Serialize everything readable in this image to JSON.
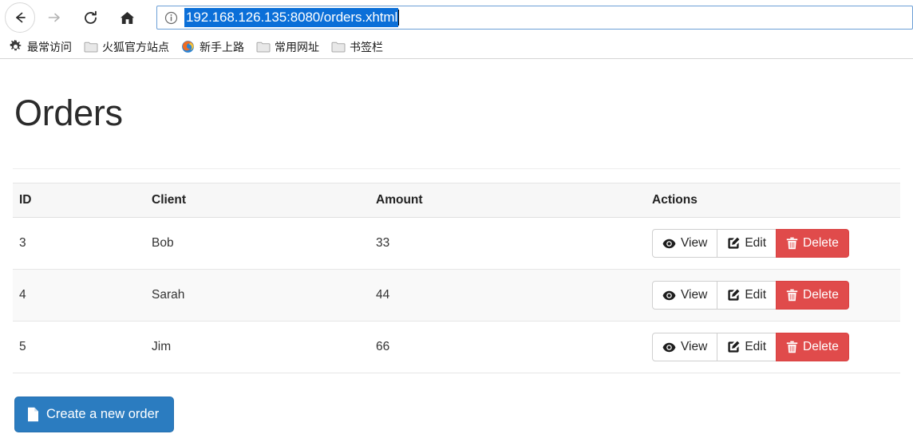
{
  "browser": {
    "nav": {
      "back_label": "Back",
      "forward_label": "Forward",
      "reload_label": "Reload",
      "home_label": "Home"
    },
    "url_bar": {
      "value": "192.168.126.135:8080/orders.xhtml",
      "identity_icon": "info-circle-icon",
      "selected": true,
      "selection_color": "#0b6fd8"
    },
    "bookmarks": [
      {
        "label": "最常访问",
        "icon": "gear-icon"
      },
      {
        "label": "火狐官方站点",
        "icon": "folder-icon"
      },
      {
        "label": "新手上路",
        "icon": "firefox-logo-icon"
      },
      {
        "label": "常用网址",
        "icon": "folder-icon"
      },
      {
        "label": "书签栏",
        "icon": "folder-icon"
      }
    ]
  },
  "page": {
    "title": "Orders",
    "table": {
      "columns": [
        "ID",
        "Client",
        "Amount",
        "Actions"
      ],
      "rows": [
        {
          "id": "3",
          "client": "Bob",
          "amount": "33"
        },
        {
          "id": "4",
          "client": "Sarah",
          "amount": "44"
        },
        {
          "id": "5",
          "client": "Jim",
          "amount": "66"
        }
      ],
      "actions": {
        "view_label": "View",
        "edit_label": "Edit",
        "delete_label": "Delete",
        "view_icon": "eye-icon",
        "edit_icon": "pen-to-square-icon",
        "delete_icon": "trash-icon",
        "delete_color": "#e04b4b"
      }
    },
    "create_button": {
      "label": "Create a new order",
      "icon": "file-icon",
      "color": "#2b7cc0"
    }
  }
}
